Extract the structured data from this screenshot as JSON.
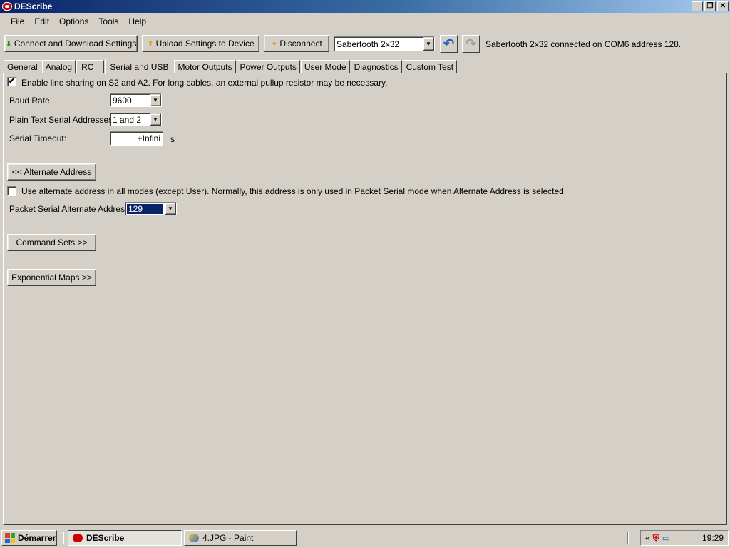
{
  "window": {
    "title": "DEScribe",
    "controls": [
      "_",
      "❐",
      "✕"
    ]
  },
  "menu": [
    "File",
    "Edit",
    "Options",
    "Tools",
    "Help"
  ],
  "toolbar": {
    "connect_label": "Connect and Download Settings",
    "upload_label": "Upload Settings to Device",
    "disconnect_label": "Disconnect",
    "device_select": "Sabertooth 2x32",
    "status": "Sabertooth 2x32 connected on COM6 address 128."
  },
  "tabs": [
    "General",
    "Analog",
    "RC",
    "Serial and USB",
    "Motor Outputs",
    "Power Outputs",
    "User Mode",
    "Diagnostics",
    "Custom Test"
  ],
  "active_tab": "Serial and USB",
  "serial": {
    "line_sharing_label": "Enable line sharing on S2 and A2. For long cables, an external pullup resistor may be necessary.",
    "line_sharing_checked": true,
    "baud_label": "Baud Rate:",
    "baud_value": "9600",
    "plain_text_label": "Plain Text Serial Addresses:",
    "plain_text_value": "1 and 2",
    "timeout_label": "Serial Timeout:",
    "timeout_value": "+Infini",
    "timeout_unit": "s",
    "alternate_button": "<< Alternate Address",
    "use_alternate_label": "Use alternate address in all modes (except User). Normally, this address is only used in Packet Serial mode when Alternate Address is selected.",
    "use_alternate_checked": false,
    "packet_alt_label": "Packet Serial Alternate Address:",
    "packet_alt_value": "129",
    "command_sets_button": "Command Sets >>",
    "exponential_maps_button": "Exponential Maps >>"
  },
  "taskbar": {
    "start_label": "Démarrer",
    "tasks": [
      "DEScribe",
      "4.JPG - Paint"
    ],
    "tray_chevron": "«",
    "clock": "19:29"
  }
}
